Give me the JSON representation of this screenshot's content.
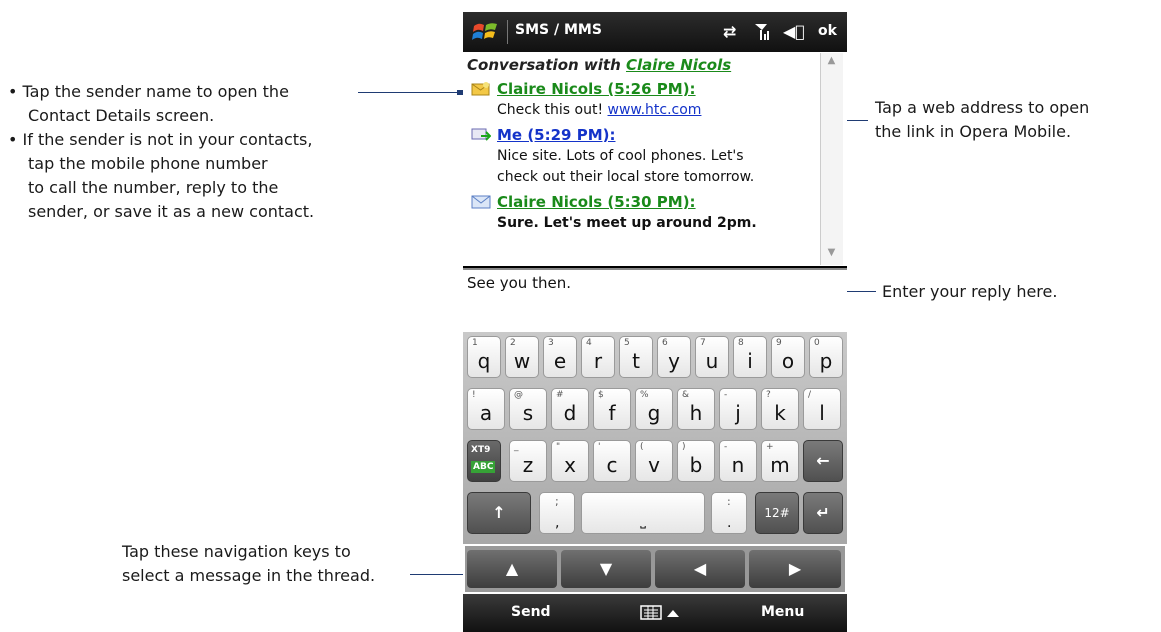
{
  "annotations": {
    "left_top": {
      "line1": "• Tap the sender name to open the",
      "line2": "Contact Details screen.",
      "line3": "• If the sender is not in your contacts,",
      "line4": "tap the mobile phone number",
      "line5": "to call the number, reply to the",
      "line6": "sender, or save it as a new contact."
    },
    "right_top": {
      "line1": "Tap a web address to open",
      "line2": "the link in Opera Mobile."
    },
    "right_mid": "Enter your reply here.",
    "left_bottom": {
      "line1": "Tap these navigation keys to",
      "line2": "select a message in the thread."
    }
  },
  "colors": {
    "annotation_line": "#1f3b73",
    "green_link": "#1a8a1a",
    "blue_link": "#1433c9"
  },
  "titlebar": {
    "title": "SMS / MMS",
    "ok": "ok",
    "icons": [
      "windows-start-icon",
      "data-connection-icon",
      "signal-icon",
      "volume-icon"
    ]
  },
  "thread": {
    "header_prefix": "Conversation with ",
    "contact_name": "Claire Nicols",
    "messages": [
      {
        "sender": "Claire Nicols (5:26 PM):",
        "text": "Check this out! ",
        "link": "www.htc.com",
        "icon": "received-message-icon"
      },
      {
        "sender": "Me (5:29 PM):",
        "text1": "Nice site. Lots of cool phones. Let's",
        "text2": "check out their local store tomorrow.",
        "icon": "sent-message-icon"
      },
      {
        "sender": "Claire Nicols (5:30 PM):",
        "text": "Sure. Let's meet up around 2pm.",
        "icon": "unread-envelope-icon"
      }
    ]
  },
  "reply": {
    "value": "See you then."
  },
  "keyboard": {
    "row1": [
      [
        "1",
        "q"
      ],
      [
        "2",
        "w"
      ],
      [
        "3",
        "e"
      ],
      [
        "4",
        "r"
      ],
      [
        "5",
        "t"
      ],
      [
        "6",
        "y"
      ],
      [
        "7",
        "u"
      ],
      [
        "8",
        "i"
      ],
      [
        "9",
        "o"
      ],
      [
        "0",
        "p"
      ]
    ],
    "row2": [
      [
        "!",
        "a"
      ],
      [
        "@",
        "s"
      ],
      [
        "#",
        "d"
      ],
      [
        "$",
        "f"
      ],
      [
        "%",
        "g"
      ],
      [
        "&",
        "h"
      ],
      [
        "-",
        "j"
      ],
      [
        "?",
        "k"
      ],
      [
        "/",
        "l"
      ]
    ],
    "row3": [
      [
        "_",
        "z"
      ],
      [
        "\"",
        "x"
      ],
      [
        "'",
        "c"
      ],
      [
        "(",
        "v"
      ],
      [
        ")",
        "b"
      ],
      [
        "-",
        "n"
      ],
      [
        "+",
        "m"
      ]
    ],
    "xt9_top": "XT9",
    "xt9_bottom": "ABC",
    "key_12": "12#",
    "semicolon_top": ";",
    "semicolon_bottom": ",",
    "colon_top": ":",
    "colon_bottom": ".",
    "space_glyph": "⎵"
  },
  "nav": {
    "up": "▲",
    "down": "▼",
    "left": "◀",
    "right": "▶"
  },
  "softbar": {
    "left": "Send",
    "right": "Menu",
    "center_icon": "keyboard-toggle-icon"
  }
}
